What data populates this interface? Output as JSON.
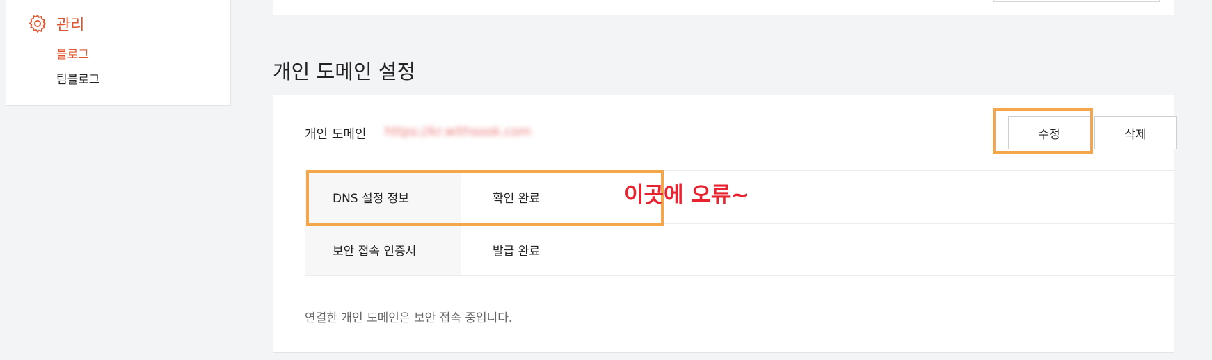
{
  "sidebar": {
    "menu_title": "관리",
    "menu_icon": "gear-icon",
    "items": [
      {
        "label": "블로그",
        "active": true
      },
      {
        "label": "팀블로그",
        "active": false
      }
    ]
  },
  "section": {
    "title": "개인 도메인 설정"
  },
  "domain": {
    "label": "개인 도메인",
    "value": "https://kr.withsook.com"
  },
  "buttons": {
    "edit": "수정",
    "delete": "삭제"
  },
  "info_rows": [
    {
      "label": "DNS 설정 정보",
      "value": "확인 완료"
    },
    {
      "label": "보안 접속 인증서",
      "value": "발급 완료"
    }
  ],
  "annotation": "이곳에 오류~",
  "note": "연결한 개인 도메인은 보안 접속 중입니다.",
  "colors": {
    "accent": "#e0552e",
    "highlight": "#f5a54a",
    "annotation": "#e8232f"
  }
}
